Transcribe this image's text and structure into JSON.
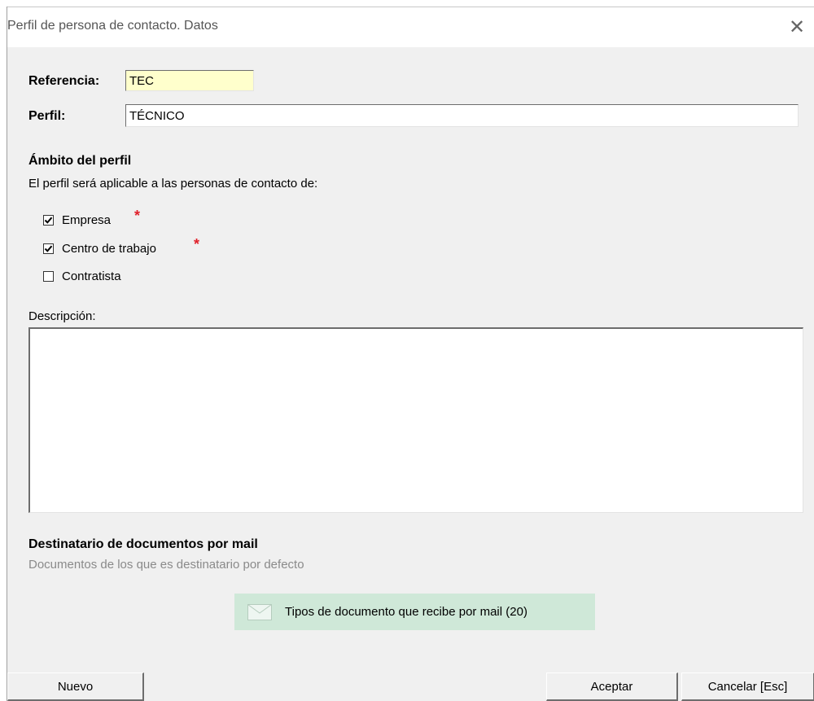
{
  "window": {
    "title": "Perfil de persona de contacto. Datos",
    "close_glyph": "✕"
  },
  "form": {
    "referencia_label": "Referencia:",
    "referencia_value": "TEC",
    "perfil_label": "Perfil:",
    "perfil_value": "TÉCNICO"
  },
  "ambito": {
    "title": "Ámbito del perfil",
    "subtitle": "El perfil será aplicable a las personas de contacto de:",
    "options": [
      {
        "label": "Empresa",
        "checked": true,
        "required": true
      },
      {
        "label": "Centro de trabajo",
        "checked": true,
        "required": true
      },
      {
        "label": "Contratista",
        "checked": false,
        "required": false
      }
    ],
    "required_mark": "*"
  },
  "descripcion": {
    "label": "Descripción:",
    "value": ""
  },
  "destinatario": {
    "title": "Destinatario de documentos por mail",
    "subtitle": "Documentos de los que es destinatario por defecto",
    "button_label": "Tipos de documento que recibe por mail  (20)",
    "button_icon": "envelope-icon"
  },
  "buttons": {
    "nuevo": "Nuevo",
    "aceptar": "Aceptar",
    "cancelar": "Cancelar [Esc]"
  },
  "colors": {
    "referencia_bg": "#ffffcc",
    "required_star": "#e0202a",
    "mail_button_bg": "#cfe8d8",
    "window_bg": "#f0f0f0"
  }
}
